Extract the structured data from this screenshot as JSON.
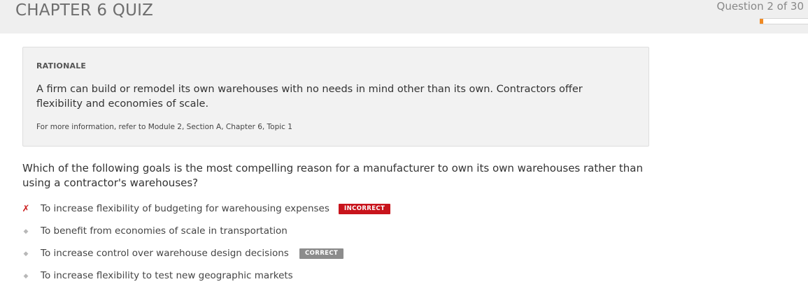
{
  "header": {
    "title": "CHAPTER 6 QUIZ",
    "counter": "Question 2 of 30",
    "progress_fraction": 0.067,
    "accent_color": "#f08a24"
  },
  "rationale": {
    "heading": "RATIONALE",
    "text": "A firm can build or remodel its own warehouses with no needs in mind other than its own. Contractors offer flexibility and economies of scale.",
    "reference": "For more information, refer to Module 2, Section A, Chapter 6, Topic 1"
  },
  "question": {
    "text": "Which of the following goals is the most compelling reason for a manufacturer to own its own warehouses rather than using a contractor's warehouses?"
  },
  "options": [
    {
      "label": "To increase flexibility of budgeting for warehousing expenses",
      "marker": "wrong-mark-icon",
      "badge": "INCORRECT"
    },
    {
      "label": "To benefit from economies of scale in transportation",
      "marker": "bullet-icon",
      "badge": ""
    },
    {
      "label": "To increase control over warehouse design decisions",
      "marker": "bullet-icon",
      "badge": "CORRECT"
    },
    {
      "label": "To increase flexibility to test new geographic markets",
      "marker": "bullet-icon",
      "badge": ""
    }
  ],
  "colors": {
    "incorrect_badge": "#c8141c",
    "correct_badge": "#8c8c8c",
    "wrong_mark": "#cc1f1f"
  }
}
